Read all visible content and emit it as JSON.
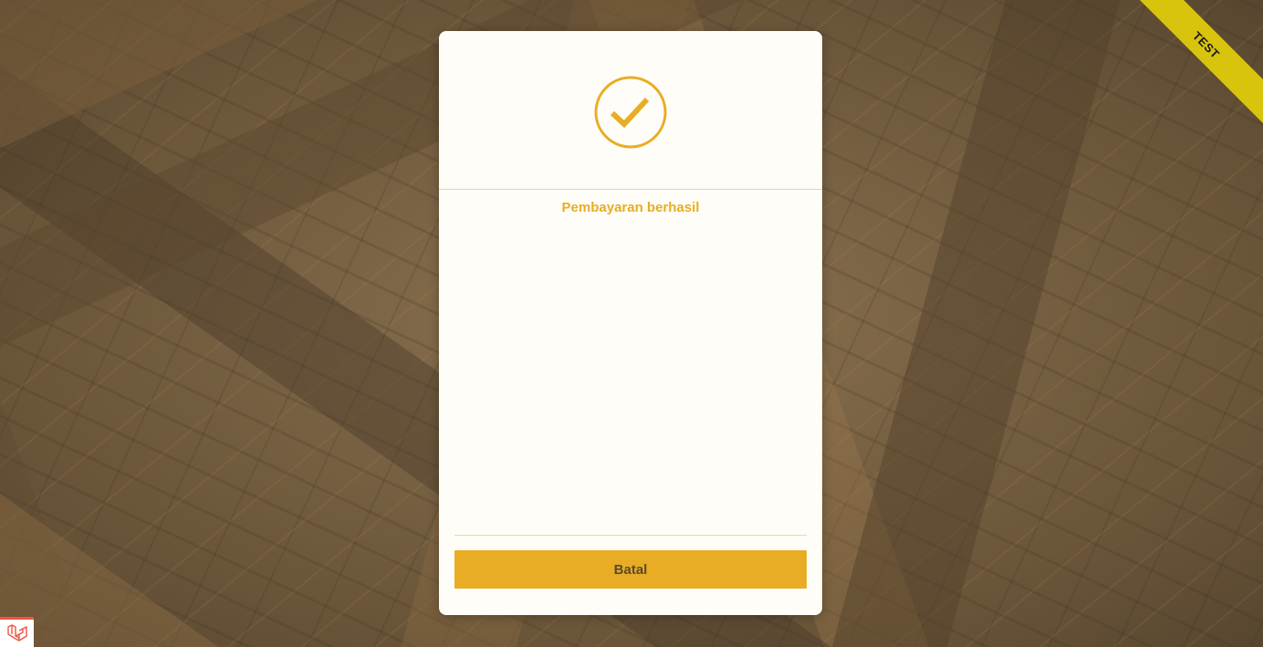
{
  "ribbon": {
    "label": "TEST",
    "color": "#d8c40c"
  },
  "modal": {
    "status_icon": "check-circle-icon",
    "status_text": "Pembayaran berhasil",
    "cancel_label": "Batal",
    "accent_color": "#e8ad24"
  },
  "corner_badge": {
    "icon": "laravel-logo-icon",
    "color": "#f05340"
  }
}
